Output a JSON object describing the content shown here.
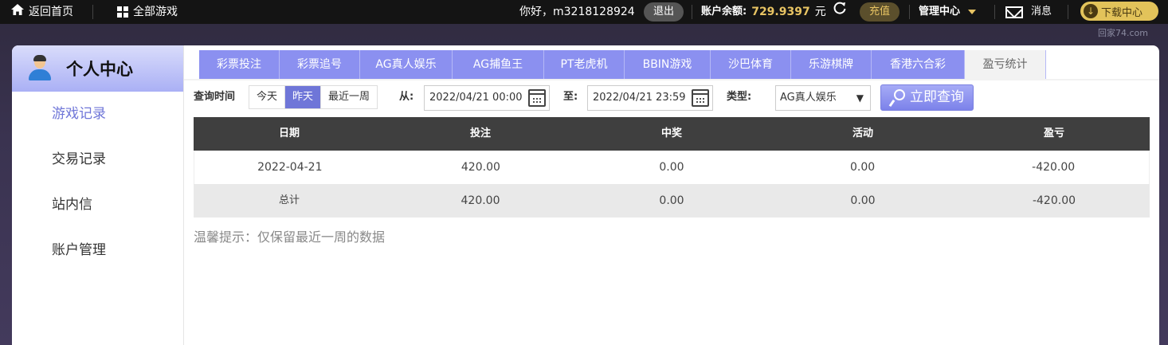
{
  "topbar": {
    "home_label": "返回首页",
    "games_label": "全部游戏",
    "greeting": "你好，m3218128924",
    "logout_label": "退出",
    "balance_label": "账户余额:",
    "balance_value": "729.9397",
    "currency": "元",
    "recharge_label": "充值",
    "manage_label": "管理中心",
    "messages_label": "消息",
    "download_label": "下载中心"
  },
  "watermark": "回家74.com",
  "sidebar": {
    "title": "个人中心",
    "items": [
      {
        "label": "游戏记录",
        "active": true
      },
      {
        "label": "交易记录",
        "active": false
      },
      {
        "label": "站内信",
        "active": false
      },
      {
        "label": "账户管理",
        "active": false
      }
    ]
  },
  "tabs": [
    {
      "label": "彩票投注",
      "active": false
    },
    {
      "label": "彩票追号",
      "active": false
    },
    {
      "label": "AG真人娱乐",
      "active": false
    },
    {
      "label": "AG捕鱼王",
      "active": false
    },
    {
      "label": "PT老虎机",
      "active": false
    },
    {
      "label": "BBIN游戏",
      "active": false
    },
    {
      "label": "沙巴体育",
      "active": false
    },
    {
      "label": "乐游棋牌",
      "active": false
    },
    {
      "label": "香港六合彩",
      "active": false
    },
    {
      "label": "盈亏统计",
      "active": true
    }
  ],
  "query": {
    "time_label": "查询时间",
    "ranges": [
      {
        "label": "今天",
        "active": false
      },
      {
        "label": "昨天",
        "active": true
      },
      {
        "label": "最近一周",
        "active": false
      }
    ],
    "from_label": "从:",
    "from_value": "2022/04/21 00:00",
    "to_label": "至:",
    "to_value": "2022/04/21 23:59",
    "type_label": "类型:",
    "type_value": "AG真人娱乐",
    "search_label": "立即查询"
  },
  "table": {
    "headers": [
      "日期",
      "投注",
      "中奖",
      "活动",
      "盈亏"
    ],
    "rows": [
      [
        "2022-04-21",
        "420.00",
        "0.00",
        "0.00",
        "-420.00"
      ]
    ],
    "total": [
      "总计",
      "420.00",
      "0.00",
      "0.00",
      "-420.00"
    ]
  },
  "tip": "温馨提示：仅保留最近一周的数据"
}
